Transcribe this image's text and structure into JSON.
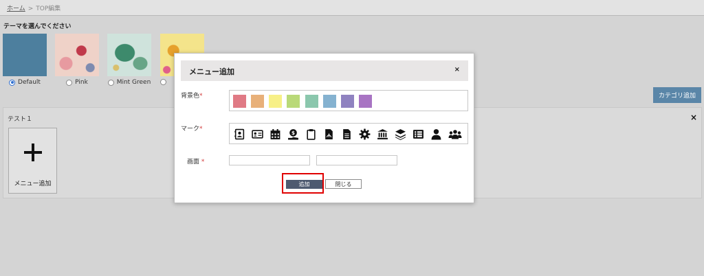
{
  "breadcrumb": {
    "home": "ホーム",
    "separator": ">",
    "current": "TOP編集"
  },
  "themes": {
    "heading": "テーマを選んでください",
    "options": [
      {
        "label": "Default",
        "selected": true
      },
      {
        "label": "Pink",
        "selected": false
      },
      {
        "label": "Mint Green",
        "selected": false
      }
    ]
  },
  "category": {
    "add_button": "カテゴリ追加",
    "title": "テスト１",
    "close": "×",
    "card_label": "メニュー追加"
  },
  "modal": {
    "title": "メニュー追加",
    "close": "×",
    "bg_color_label": "背景色",
    "mark_label": "マーク",
    "screen_label": "画面",
    "required_mark": "*",
    "colors": [
      "#e07a85",
      "#e8b079",
      "#f7f087",
      "#b9d978",
      "#8bc7ad",
      "#85b2d0",
      "#8f82c0",
      "#a874c3"
    ],
    "icons": [
      "contact-book-icon",
      "id-card-icon",
      "calendar-icon",
      "money-hand-icon",
      "clipboard-icon",
      "pdf-file-icon",
      "document-icon",
      "gear-icon",
      "bank-icon",
      "layers-icon",
      "list-icon",
      "user-icon",
      "users-icon"
    ],
    "screen_inputs": [
      {
        "value": "",
        "placeholder": ""
      },
      {
        "value": "",
        "placeholder": ""
      }
    ],
    "add_button": "追加",
    "close_button": "閉じる"
  }
}
